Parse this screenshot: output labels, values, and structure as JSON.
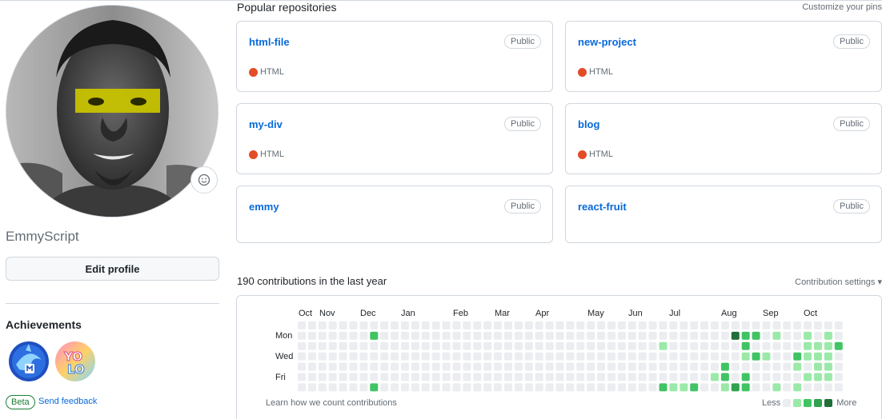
{
  "profile": {
    "username": "EmmyScript",
    "edit_profile_label": "Edit profile",
    "achievements_title": "Achievements",
    "achievements": [
      {
        "name": "shark-badge-icon"
      },
      {
        "name": "yolo-badge-icon"
      }
    ],
    "beta_label": "Beta",
    "feedback_label": "Send feedback",
    "status_icon": "smiley-icon"
  },
  "pins": {
    "title": "Popular repositories",
    "customize_label": "Customize your pins",
    "repos": [
      {
        "name": "html-file",
        "visibility": "Public",
        "language": "HTML",
        "lang_color": "#e34c26"
      },
      {
        "name": "new-project",
        "visibility": "Public",
        "language": "HTML",
        "lang_color": "#e34c26"
      },
      {
        "name": "my-div",
        "visibility": "Public",
        "language": "HTML",
        "lang_color": "#e34c26"
      },
      {
        "name": "blog",
        "visibility": "Public",
        "language": "HTML",
        "lang_color": "#e34c26"
      },
      {
        "name": "emmy",
        "visibility": "Public",
        "language": "",
        "lang_color": ""
      },
      {
        "name": "react-fruit",
        "visibility": "Public",
        "language": "",
        "lang_color": ""
      }
    ]
  },
  "contributions": {
    "title": "190 contributions in the last year",
    "settings_label": "Contribution settings",
    "months": [
      "Oct",
      "Nov",
      "Dec",
      "Jan",
      "Feb",
      "Mar",
      "Apr",
      "May",
      "Jun",
      "Jul",
      "Aug",
      "Sep",
      "Oct"
    ],
    "days": [
      "Mon",
      "Wed",
      "Fri"
    ],
    "learn_label": "Learn how we count contributions",
    "legend_less": "Less",
    "legend_more": "More",
    "colors": [
      "#ebedf0",
      "#9be9a8",
      "#40c463",
      "#30a14e",
      "#216e39"
    ],
    "weeks": 53,
    "levels": [
      {
        "week": 7,
        "day": 1,
        "level": 2
      },
      {
        "week": 7,
        "day": 6,
        "level": 2
      },
      {
        "week": 35,
        "day": 2,
        "level": 1
      },
      {
        "week": 35,
        "day": 6,
        "level": 2
      },
      {
        "week": 36,
        "day": 6,
        "level": 1
      },
      {
        "week": 37,
        "day": 6,
        "level": 1
      },
      {
        "week": 38,
        "day": 6,
        "level": 2
      },
      {
        "week": 40,
        "day": 5,
        "level": 1
      },
      {
        "week": 41,
        "day": 4,
        "level": 2
      },
      {
        "week": 41,
        "day": 5,
        "level": 2
      },
      {
        "week": 41,
        "day": 6,
        "level": 1
      },
      {
        "week": 42,
        "day": 1,
        "level": 4
      },
      {
        "week": 42,
        "day": 6,
        "level": 3
      },
      {
        "week": 43,
        "day": 1,
        "level": 2
      },
      {
        "week": 43,
        "day": 2,
        "level": 2
      },
      {
        "week": 43,
        "day": 3,
        "level": 1
      },
      {
        "week": 43,
        "day": 5,
        "level": 2
      },
      {
        "week": 43,
        "day": 6,
        "level": 2
      },
      {
        "week": 44,
        "day": 1,
        "level": 2
      },
      {
        "week": 44,
        "day": 3,
        "level": 2
      },
      {
        "week": 45,
        "day": 3,
        "level": 1
      },
      {
        "week": 46,
        "day": 1,
        "level": 1
      },
      {
        "week": 46,
        "day": 6,
        "level": 1
      },
      {
        "week": 48,
        "day": 3,
        "level": 2
      },
      {
        "week": 48,
        "day": 4,
        "level": 1
      },
      {
        "week": 48,
        "day": 6,
        "level": 1
      },
      {
        "week": 49,
        "day": 1,
        "level": 1
      },
      {
        "week": 49,
        "day": 2,
        "level": 1
      },
      {
        "week": 49,
        "day": 3,
        "level": 1
      },
      {
        "week": 49,
        "day": 5,
        "level": 1
      },
      {
        "week": 50,
        "day": 2,
        "level": 1
      },
      {
        "week": 50,
        "day": 3,
        "level": 1
      },
      {
        "week": 50,
        "day": 4,
        "level": 1
      },
      {
        "week": 50,
        "day": 5,
        "level": 1
      },
      {
        "week": 51,
        "day": 1,
        "level": 1
      },
      {
        "week": 51,
        "day": 2,
        "level": 1
      },
      {
        "week": 51,
        "day": 3,
        "level": 1
      },
      {
        "week": 51,
        "day": 4,
        "level": 1
      },
      {
        "week": 51,
        "day": 5,
        "level": 1
      },
      {
        "week": 52,
        "day": 2,
        "level": 2
      }
    ]
  }
}
